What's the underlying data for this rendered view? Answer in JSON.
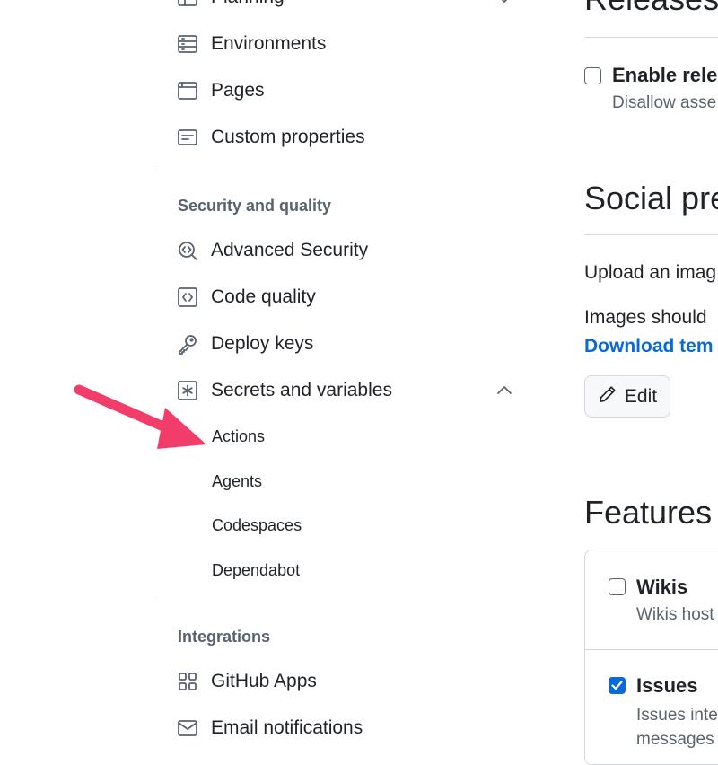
{
  "sidebar": {
    "items_top": [
      {
        "label": "Planning",
        "icon": "planning-icon"
      },
      {
        "label": "Environments",
        "icon": "server-icon"
      },
      {
        "label": "Pages",
        "icon": "browser-icon"
      },
      {
        "label": "Custom properties",
        "icon": "note-icon"
      }
    ],
    "security_heading": "Security and quality",
    "security_items": [
      {
        "label": "Advanced Security",
        "icon": "codescan-icon"
      },
      {
        "label": "Code quality",
        "icon": "code-square-icon"
      },
      {
        "label": "Deploy keys",
        "icon": "key-icon"
      },
      {
        "label": "Secrets and variables",
        "icon": "asterisk-icon"
      }
    ],
    "secrets_subitems": [
      "Actions",
      "Agents",
      "Codespaces",
      "Dependabot"
    ],
    "integrations_heading": "Integrations",
    "integrations_items": [
      {
        "label": "GitHub Apps",
        "icon": "apps-icon"
      },
      {
        "label": "Email notifications",
        "icon": "mail-icon"
      }
    ]
  },
  "main": {
    "releases": {
      "heading": "Releases",
      "checkbox_label": "Enable rele",
      "checkbox_desc": "Disallow asse",
      "checked": false
    },
    "social": {
      "heading": "Social pre",
      "text1": "Upload an imag",
      "text2": "Images should",
      "link": "Download tem",
      "edit_label": "Edit"
    },
    "features": {
      "heading": "Features",
      "wikis_label": "Wikis",
      "wikis_desc": "Wikis host",
      "wikis_checked": false,
      "issues_label": "Issues",
      "issues_desc1": "Issues inte",
      "issues_desc2": "messages",
      "issues_checked": true
    }
  },
  "annotation": {
    "color": "#f23d6a",
    "icon": "arrow-annotation"
  },
  "colors": {
    "accent": "#0969da",
    "muted": "#59636e",
    "border": "#d1d9e0"
  }
}
